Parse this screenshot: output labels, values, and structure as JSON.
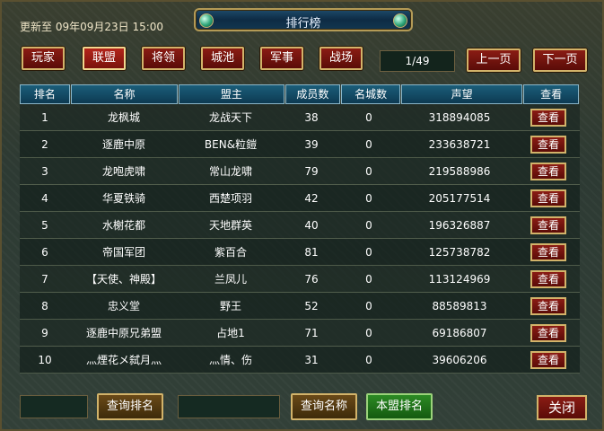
{
  "title": "排行榜",
  "update_text": "更新至 09年09月23日 15:00",
  "tabs": [
    {
      "label": "玩家",
      "active": false
    },
    {
      "label": "联盟",
      "active": true
    },
    {
      "label": "将领",
      "active": false
    },
    {
      "label": "城池",
      "active": false
    },
    {
      "label": "军事",
      "active": false
    },
    {
      "label": "战场",
      "active": false
    }
  ],
  "pager": {
    "page": "1/49",
    "prev_label": "上一页",
    "next_label": "下一页"
  },
  "columns": [
    "排名",
    "名称",
    "盟主",
    "成员数",
    "名城数",
    "声望",
    "查看"
  ],
  "rows": [
    {
      "rank": "1",
      "name": "龙枫城",
      "leader": "龙战天下",
      "members": "38",
      "cities": "0",
      "prestige": "318894085",
      "view": "查看"
    },
    {
      "rank": "2",
      "name": "逐鹿中原",
      "leader": "BEN&粒鎧",
      "members": "39",
      "cities": "0",
      "prestige": "233638721",
      "view": "查看"
    },
    {
      "rank": "3",
      "name": "龙咆虎啸",
      "leader": "常山龙啸",
      "members": "79",
      "cities": "0",
      "prestige": "219588986",
      "view": "查看"
    },
    {
      "rank": "4",
      "name": "华夏铁骑",
      "leader": "西楚项羽",
      "members": "42",
      "cities": "0",
      "prestige": "205177514",
      "view": "查看"
    },
    {
      "rank": "5",
      "name": "水榭花都",
      "leader": "天地群英",
      "members": "40",
      "cities": "0",
      "prestige": "196326887",
      "view": "查看"
    },
    {
      "rank": "6",
      "name": "帝国军团",
      "leader": "紫百合",
      "members": "81",
      "cities": "0",
      "prestige": "125738782",
      "view": "查看"
    },
    {
      "rank": "7",
      "name": "【天使、神殿】",
      "leader": "兰凤儿",
      "members": "76",
      "cities": "0",
      "prestige": "113124969",
      "view": "查看"
    },
    {
      "rank": "8",
      "name": "忠义堂",
      "leader": "野王",
      "members": "52",
      "cities": "0",
      "prestige": "88589813",
      "view": "查看"
    },
    {
      "rank": "9",
      "name": "逐鹿中原兄弟盟",
      "leader": "占地1",
      "members": "71",
      "cities": "0",
      "prestige": "69186807",
      "view": "查看"
    },
    {
      "rank": "10",
      "name": "灬煙花メ弑月灬",
      "leader": "灬情、伤",
      "members": "31",
      "cities": "0",
      "prestige": "39606206",
      "view": "查看"
    }
  ],
  "bottom": {
    "query_rank_label": "查询排名",
    "query_name_label": "查询名称",
    "my_alliance_label": "本盟排名",
    "close_label": "关闭"
  }
}
